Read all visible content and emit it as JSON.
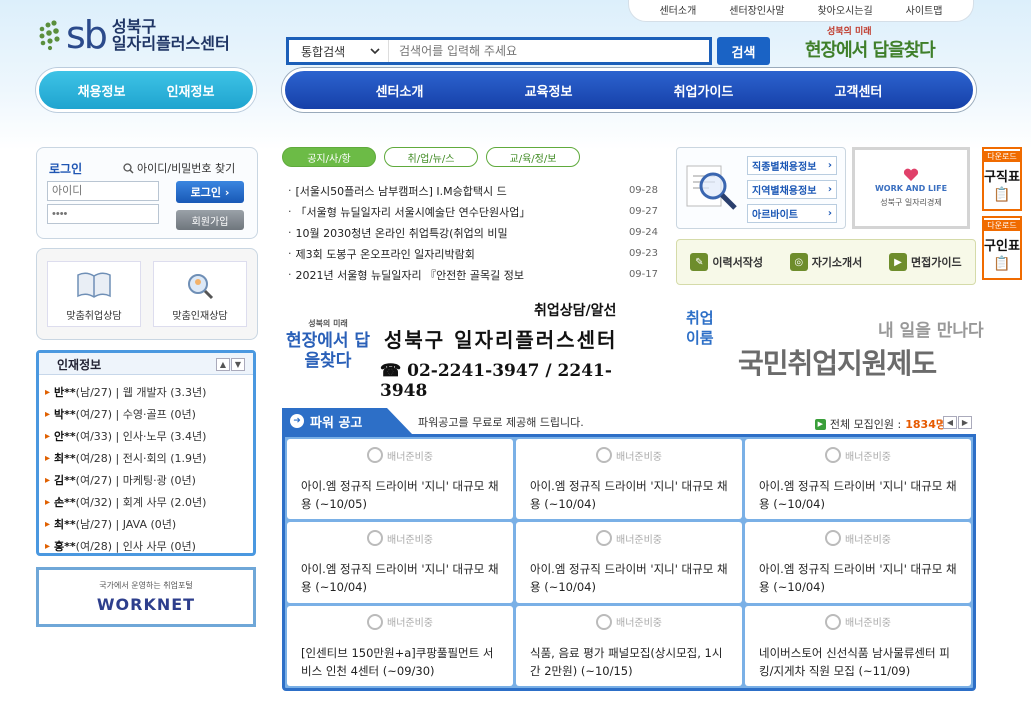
{
  "util": [
    "센터소개",
    "센터장인사말",
    "찾아오시는길",
    "사이트맵"
  ],
  "logo": {
    "mark": "sb",
    "line1": "성북구",
    "line2": "일자리플러스센터"
  },
  "search": {
    "select": "통합검색",
    "placeholder": "검색어를 입력해 주세요",
    "button": "검색"
  },
  "slogan": {
    "line1": "성북의 미래",
    "line2": "현장에서 답을찾다"
  },
  "nav_left": [
    "채용정보",
    "인재정보"
  ],
  "nav_main": [
    "센터소개",
    "교육정보",
    "취업가이드",
    "고객센터"
  ],
  "login": {
    "title": "로그인",
    "find": "아이디/비밀번호 찾기",
    "id_placeholder": "아이디",
    "pw_placeholder": "••••",
    "button": "로그인",
    "join": "회원가입"
  },
  "consult": [
    "맞춤취업상담",
    "맞춤인재상담"
  ],
  "talent": {
    "title": "인재정보",
    "rows": [
      {
        "name": "반**",
        "meta": "(남/27) | 웹 개발자 (3.3년)"
      },
      {
        "name": "박**",
        "meta": "(여/27) | 수영·골프 (0년)"
      },
      {
        "name": "안**",
        "meta": "(여/33) | 인사·노무 (3.4년)"
      },
      {
        "name": "최**",
        "meta": "(여/28) | 전시·회의 (1.9년)"
      },
      {
        "name": "김**",
        "meta": "(여/27) | 마케팅·광 (0년)"
      },
      {
        "name": "손**",
        "meta": "(여/32) | 회계 사무 (2.0년)"
      },
      {
        "name": "최**",
        "meta": "(남/27) | JAVA (0년)"
      },
      {
        "name": "홍**",
        "meta": "(여/28) | 인사 사무 (0년)"
      }
    ]
  },
  "worknet": {
    "sub": "국가에서 운영하는 취업포털",
    "logo": "WORKNET"
  },
  "tabs": [
    "공지/사/항",
    "취/업/뉴/스",
    "교/육/정/보"
  ],
  "news": [
    {
      "title": "[서울시50플러스 남부캠퍼스] I.M승합택시 드",
      "date": "09-28"
    },
    {
      "title": "「서울형 뉴딜일자리 서울시예술단 연수단원사업」",
      "date": "09-27"
    },
    {
      "title": "10월 2030청년 온라인 취업특강(취업의 비밀",
      "date": "09-24"
    },
    {
      "title": "제3회 도봉구 온오프라인 일자리박람회",
      "date": "09-23"
    },
    {
      "title": "2021년 서울형 뉴딜일자리 『안전한 골목길 정보",
      "date": "09-17"
    }
  ],
  "job_links": [
    "직종별채용정보",
    "지역별채용정보",
    "아르바이트"
  ],
  "work_life": {
    "logo": "WORK AND LIFE",
    "text": "성북구 일자리경제"
  },
  "tools": [
    "이력서작성",
    "자기소개서",
    "면접가이드"
  ],
  "downloads": [
    {
      "top": "다운로드",
      "main": "구직표"
    },
    {
      "top": "다운로드",
      "main": "구인표"
    }
  ],
  "banner1": {
    "top": "취업상담/알선",
    "logo_top": "성북의 미래",
    "logo": "현장에서 답을찾다",
    "title": "성북구 일자리플러스센터",
    "phone": "02-2241-3947 / 2241-3948"
  },
  "banner2": {
    "side1": "취업",
    "side2": "이룸",
    "sub": "내 일을 만나다",
    "main": "국민취업지원제도"
  },
  "power": {
    "title": "파워 공고",
    "desc": "파워공고를 무료로 제공해 드립니다.",
    "count_label": "전체 모집인원 :",
    "count": "1834명",
    "badge": "배너준비중",
    "cards": [
      "아이.엠 정규직 드라이버 '지니' 대규모 채용 (~10/05)",
      "아이.엠 정규직 드라이버 '지니' 대규모 채용 (~10/04)",
      "아이.엠 정규직 드라이버 '지니' 대규모 채용 (~10/04)",
      "아이.엠 정규직 드라이버 '지니' 대규모 채용 (~10/04)",
      "아이.엠 정규직 드라이버 '지니' 대규모 채용 (~10/04)",
      "아이.엠 정규직 드라이버 '지니' 대규모 채용 (~10/04)",
      "[인센티브 150만원+a]쿠팡풀필먼트 서비스 인천 4센터 (~09/30)",
      "식품, 음료 평가 패널모집(상시모집, 1시간 2만원) (~10/15)",
      "네이버스토어 신선식품 남사물류센터 피킹/지게차 직원 모집 (~11/09)"
    ]
  },
  "colors": {
    "primary": "#1c5fb8",
    "nav_cyan": "#1fa4cf",
    "accent_orange": "#e65a00",
    "green": "#6cbb46"
  }
}
